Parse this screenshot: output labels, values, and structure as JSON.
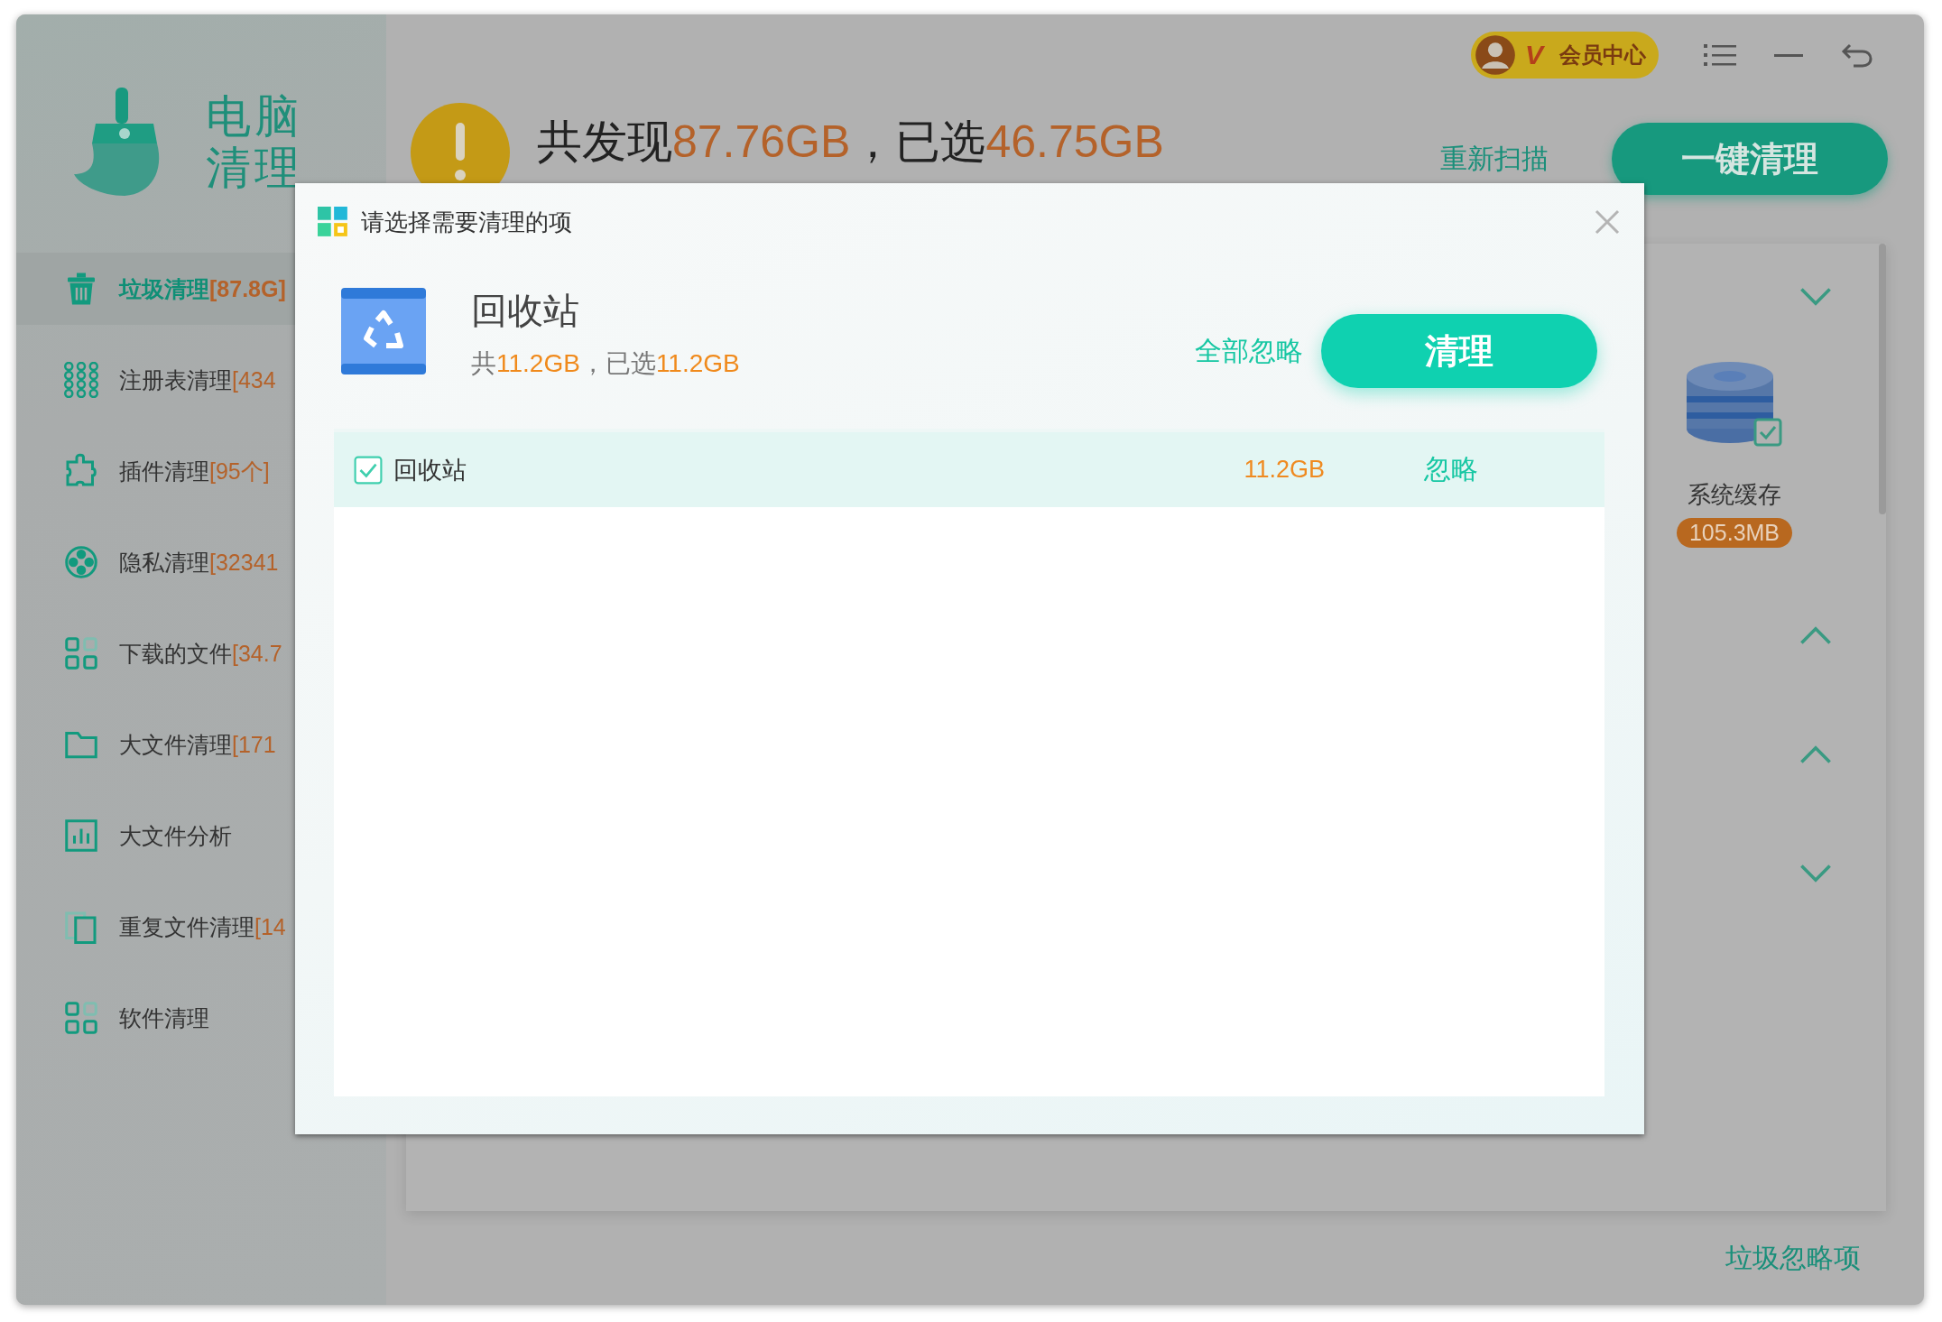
{
  "window": {
    "logo_lines": [
      "电脑",
      "清理"
    ],
    "member_badge": "V",
    "member_label": "会员中心"
  },
  "sidebar": {
    "items": [
      {
        "kind": "trash",
        "label": "垃圾清理",
        "count": "[87.8G]",
        "selected": true
      },
      {
        "kind": "dots",
        "label": "注册表清理",
        "count": "[434",
        "selected": false
      },
      {
        "kind": "puzzle",
        "label": "插件清理",
        "count": "[95个]",
        "selected": false
      },
      {
        "kind": "reel",
        "label": "隐私清理",
        "count": "[32341",
        "selected": false
      },
      {
        "kind": "grid",
        "label": "下载的文件",
        "count": "[34.7",
        "selected": false
      },
      {
        "kind": "folder",
        "label": "大文件清理",
        "count": "[171",
        "selected": false
      },
      {
        "kind": "chart",
        "label": "大文件分析",
        "selected": false
      },
      {
        "kind": "copy",
        "label": "重复文件清理",
        "count": "[14",
        "selected": false
      },
      {
        "kind": "grid",
        "label": "软件清理",
        "selected": false
      }
    ]
  },
  "header": {
    "found_label": "共发现",
    "found": "87.76GB",
    "separator": "，",
    "selected_label": "已选",
    "selected": "46.75GB",
    "rescan": "重新扫描",
    "clean_all": "一键清理"
  },
  "chevrons": [
    {
      "expanded": false
    },
    {
      "expanded": true
    },
    {
      "expanded": true
    },
    {
      "expanded": false
    }
  ],
  "cache_item": {
    "label": "系统缓存",
    "size": "105.3MB",
    "checked": true
  },
  "ignored_link": "垃圾忽略项",
  "dialog": {
    "title": "请选择需要清理的项",
    "category": "回收站",
    "total_label": "共",
    "total": "11.2GB",
    "separator": "，",
    "selected_label": "已选",
    "selected": "11.2GB",
    "ignore_all": "全部忽略",
    "clean": "清理",
    "rows": [
      {
        "name": "回收站",
        "size": "11.2GB",
        "action": "忽略",
        "checked": true
      }
    ]
  }
}
